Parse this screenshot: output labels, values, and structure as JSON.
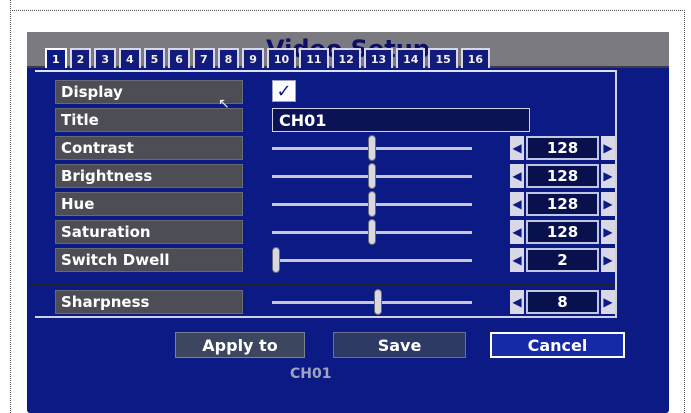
{
  "window": {
    "title": "Video Setup"
  },
  "tabs": [
    {
      "label": "1",
      "active": true
    },
    {
      "label": "2"
    },
    {
      "label": "3"
    },
    {
      "label": "4"
    },
    {
      "label": "5"
    },
    {
      "label": "6"
    },
    {
      "label": "7"
    },
    {
      "label": "8"
    },
    {
      "label": "9"
    },
    {
      "label": "10"
    },
    {
      "label": "11"
    },
    {
      "label": "12"
    },
    {
      "label": "13"
    },
    {
      "label": "14"
    },
    {
      "label": "15"
    },
    {
      "label": "16"
    }
  ],
  "rows": {
    "display": {
      "label": "Display",
      "checked": true
    },
    "title": {
      "label": "Title",
      "value": "CH01"
    },
    "contrast": {
      "label": "Contrast",
      "value": "128",
      "level": 0.5
    },
    "brightness": {
      "label": "Brightness",
      "value": "128",
      "level": 0.5
    },
    "hue": {
      "label": "Hue",
      "value": "128",
      "level": 0.5
    },
    "saturation": {
      "label": "Saturation",
      "value": "128",
      "level": 0.5
    },
    "switch_dwell": {
      "label": "Switch Dwell",
      "value": "2",
      "level": 0.02
    },
    "sharpness": {
      "label": "Sharpness",
      "value": "8",
      "level": 0.53
    }
  },
  "buttons": {
    "apply": "Apply to",
    "save": "Save",
    "cancel": "Cancel"
  },
  "footer": {
    "partial_text": "CH01"
  },
  "colors": {
    "background": "#0c1a86",
    "titlebar": "#7a7a80",
    "title_text": "#0d0f63"
  }
}
